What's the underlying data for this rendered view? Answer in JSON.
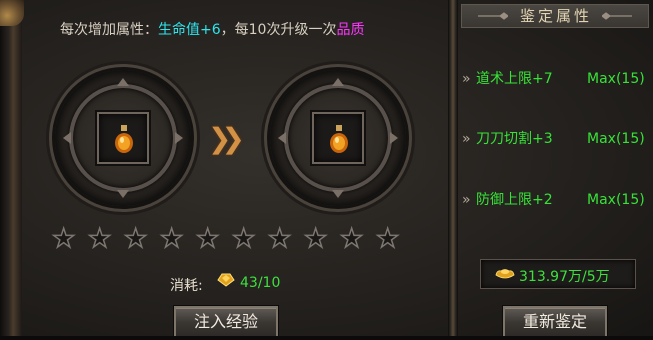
{
  "info": {
    "prefix": "每次增加属性：",
    "attr": "生命值+6",
    "middle": "，每10次升级一次",
    "quality": "品质"
  },
  "stars": {
    "total": 10,
    "filled": 0
  },
  "cost": {
    "label": "消耗:",
    "value": "43/10"
  },
  "buttons": {
    "inject": "注入经验",
    "reappraise": "重新鉴定"
  },
  "right_panel": {
    "title": "鉴定属性",
    "attributes": [
      {
        "name": "道术上限+7",
        "max": "Max(15)"
      },
      {
        "name": "刀刀切割+3",
        "max": "Max(15)"
      },
      {
        "name": "防御上限+2",
        "max": "Max(15)"
      }
    ],
    "gold": "313.97万/5万"
  },
  "colors": {
    "cyan": "#2ee6ee",
    "magenta": "#ff38ff",
    "green": "#37e237",
    "arrow": "#d39146"
  }
}
